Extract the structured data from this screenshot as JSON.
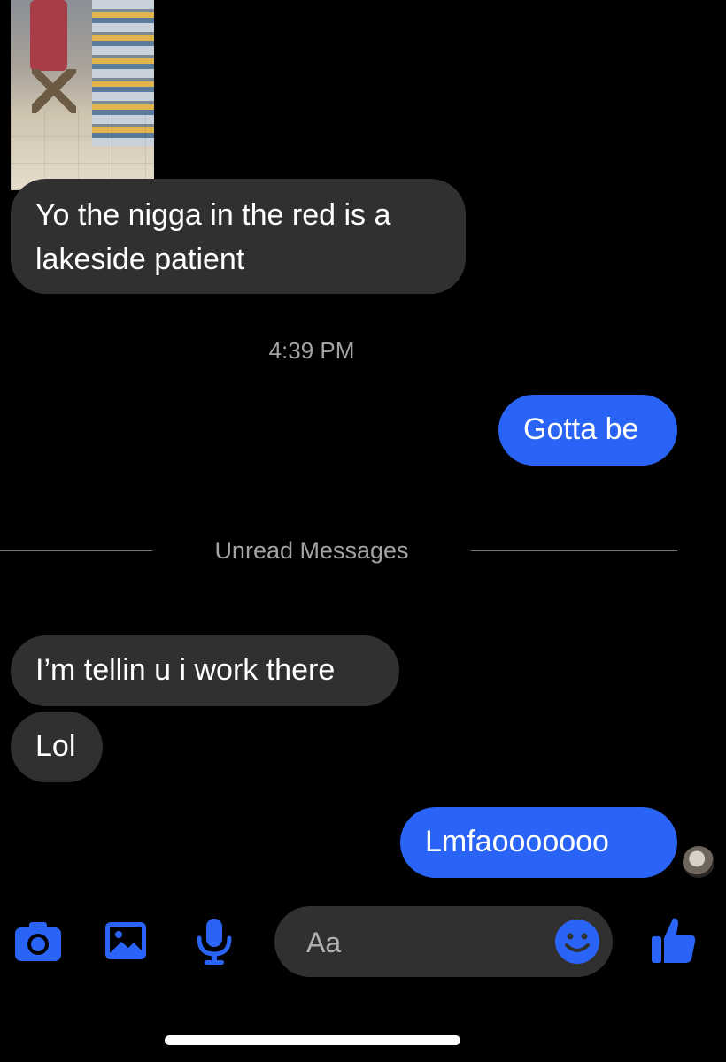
{
  "thread": {
    "media_caption": "Yo the nigga in the red is a lakeside patient",
    "timestamp": "4:39 PM",
    "unread_divider": "Unread Messages",
    "messages": [
      {
        "from": "them",
        "text": "Yo the nigga in the red is a lakeside patient"
      },
      {
        "from": "me",
        "text": "Gotta be"
      },
      {
        "from": "them",
        "text": "I’m tellin u i work there"
      },
      {
        "from": "them",
        "text": "Lol"
      },
      {
        "from": "me",
        "text": "Lmfaooooooo"
      }
    ]
  },
  "composer": {
    "placeholder": "Aa",
    "icons": [
      "camera-icon",
      "gallery-icon",
      "microphone-icon",
      "emoji-icon",
      "thumbs-up-icon"
    ]
  },
  "colors": {
    "accent": "#2a64f6",
    "incoming_bubble": "#303030",
    "background": "#000000",
    "meta_text": "#a3a3a3"
  }
}
